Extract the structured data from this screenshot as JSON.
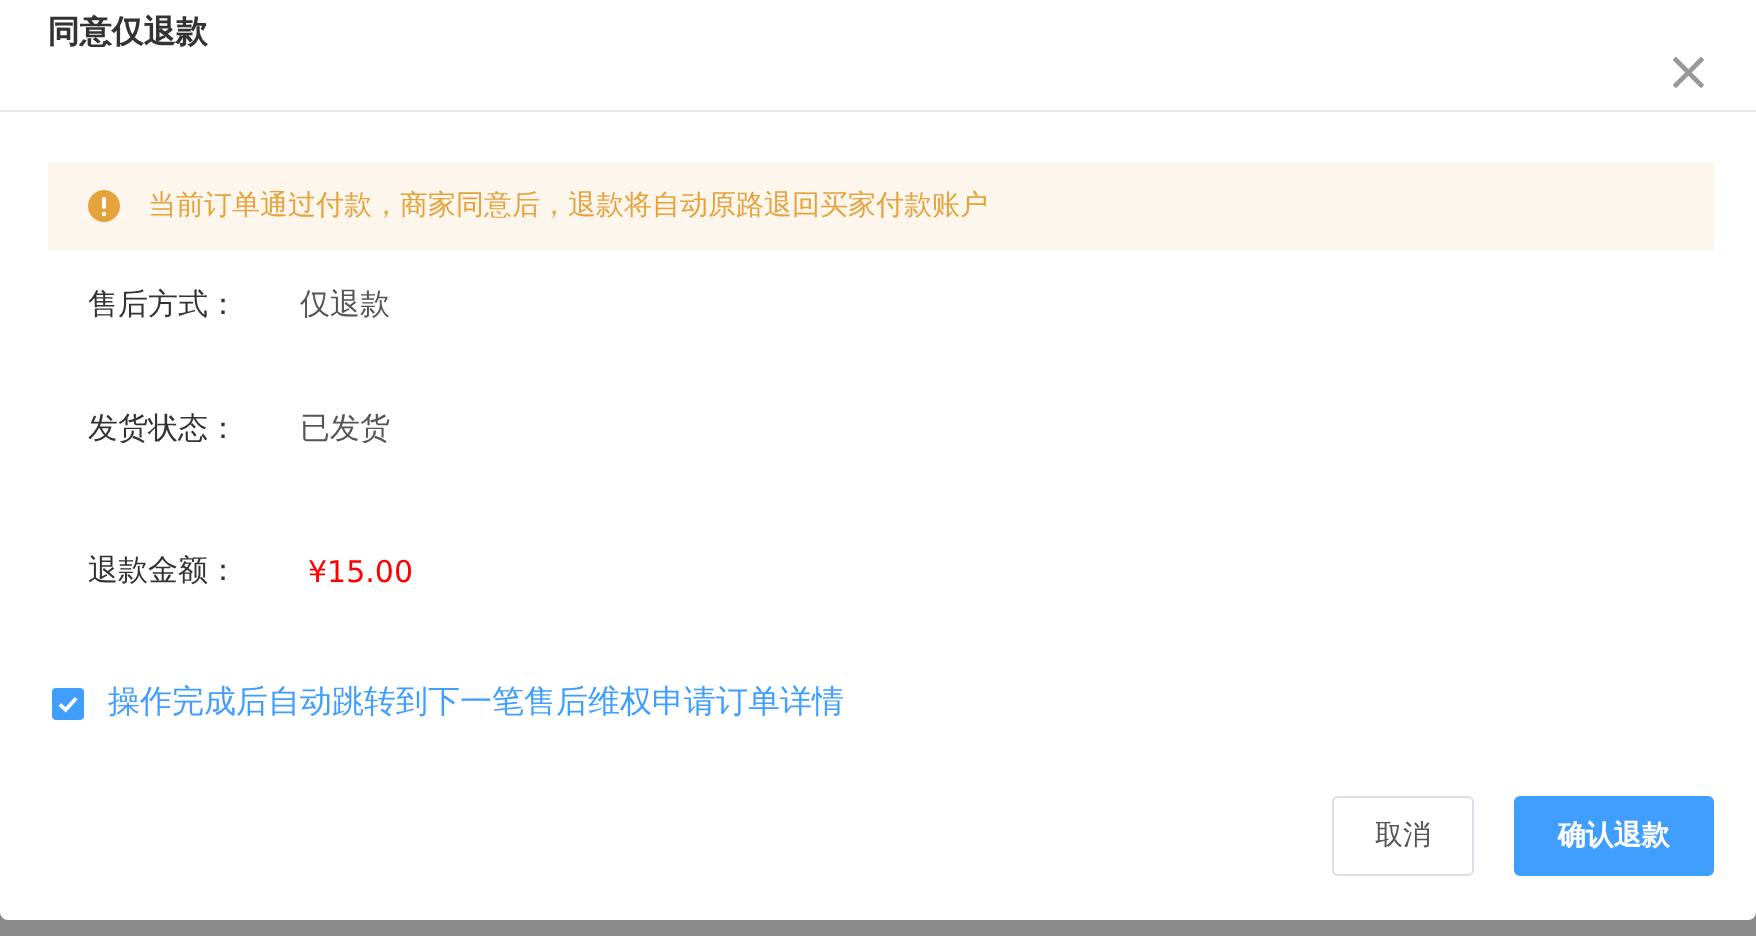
{
  "dialog": {
    "title": "同意仅退款",
    "close": "×"
  },
  "alert": {
    "text": "当前订单通过付款，商家同意后，退款将自动原路退回买家付款账户"
  },
  "fields": [
    {
      "label": "售后方式：",
      "value": "仅退款",
      "kind": "plain"
    },
    {
      "label": "发货状态：",
      "value": "已发货",
      "kind": "plain"
    },
    {
      "label": "退款金额：",
      "value": "¥15.00",
      "kind": "amount"
    }
  ],
  "auto_jump": {
    "label": "操作完成后自动跳转到下一笔售后维权申请订单详情",
    "checked": true
  },
  "buttons": [
    {
      "label": "取消",
      "kind": "secondary"
    },
    {
      "label": "确认退款",
      "kind": "primary"
    }
  ]
}
